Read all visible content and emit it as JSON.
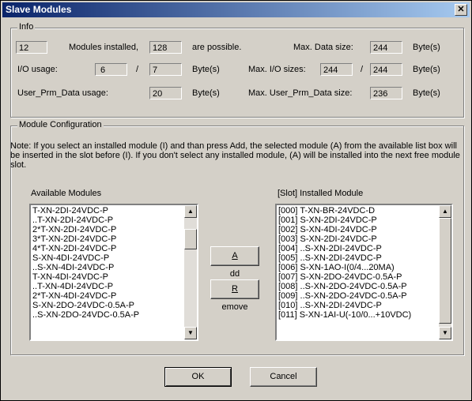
{
  "window": {
    "title": "Slave Modules",
    "close_glyph": "✕"
  },
  "info": {
    "legend": "Info",
    "modules_installed": "12",
    "modules_installed_label": "Modules installed,",
    "possible_count": "128",
    "possible_label": "are possible.",
    "max_data_label": "Max. Data size:",
    "max_data_value": "244",
    "byte_unit": "Byte(s)",
    "io_usage_label": "I/O usage:",
    "io_usage_in": "6",
    "io_usage_out": "7",
    "slash": "/",
    "max_io_label": "Max. I/O sizes:",
    "max_io_in": "244",
    "max_io_out": "244",
    "prm_usage_label": "User_Prm_Data usage:",
    "prm_usage_value": "20",
    "max_prm_label": "Max. User_Prm_Data size:",
    "max_prm_value": "236"
  },
  "config": {
    "legend": "Module Configuration",
    "note": "Note:   If you select an installed module (I) and than press Add, the selected module (A) from the available list box will be inserted in the slot before (I). If you don't select any installed module, (A) will be installed into the next free module slot.",
    "available_label": "Available Modules",
    "installed_label": "[Slot] Installed Module",
    "available": [
      "T-XN-2DI-24VDC-P",
      "..T-XN-2DI-24VDC-P",
      "2*T-XN-2DI-24VDC-P",
      "3*T-XN-2DI-24VDC-P",
      "4*T-XN-2DI-24VDC-P",
      "S-XN-4DI-24VDC-P",
      "..S-XN-4DI-24VDC-P",
      "T-XN-4DI-24VDC-P",
      "..T-XN-4DI-24VDC-P",
      "2*T-XN-4DI-24VDC-P",
      "S-XN-2DO-24VDC-0.5A-P",
      "..S-XN-2DO-24VDC-0.5A-P"
    ],
    "installed": [
      "[000] T-XN-BR-24VDC-D",
      "[001] S-XN-2DI-24VDC-P",
      "[002] S-XN-4DI-24VDC-P",
      "[003] S-XN-2DI-24VDC-P",
      "[004] ..S-XN-2DI-24VDC-P",
      "[005] ..S-XN-2DI-24VDC-P",
      "[006] S-XN-1AO-I(0/4...20MA)",
      "[007] S-XN-2DO-24VDC-0.5A-P",
      "[008] ..S-XN-2DO-24VDC-0.5A-P",
      "[009] ..S-XN-2DO-24VDC-0.5A-P",
      "[010] ..S-XN-2DI-24VDC-P",
      "[011] S-XN-1AI-U(-10/0...+10VDC)"
    ],
    "add_button_prefix": "",
    "add_button_hotkey": "A",
    "add_button_rest": "dd",
    "remove_button_hotkey": "R",
    "remove_button_rest": "emove",
    "scroll_up_glyph": "▲",
    "scroll_down_glyph": "▼"
  },
  "buttons": {
    "ok": "OK",
    "cancel": "Cancel"
  }
}
